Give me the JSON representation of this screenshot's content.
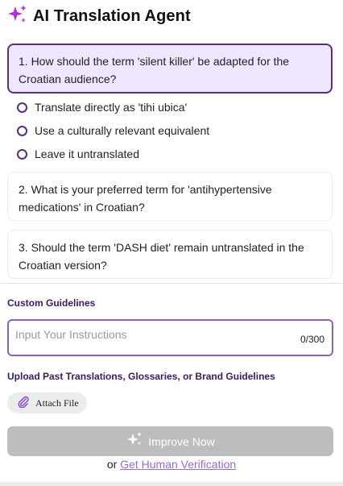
{
  "header": {
    "title": "AI Translation Agent",
    "icon": "sparkle-icon"
  },
  "questions": [
    {
      "text": "1. How should the term 'silent killer' be adapted for the Croatian audience?",
      "options": [
        "Translate directly as 'tihi ubica'",
        "Use a culturally relevant equivalent",
        "Leave it untranslated"
      ]
    },
    {
      "text": "2. What is your preferred term for 'antihypertensive medications' in Croatian?"
    },
    {
      "text": "3. Should the term 'DASH diet' remain untranslated in the Croatian version?"
    }
  ],
  "guidelines": {
    "label": "Custom Guidelines",
    "placeholder": "Input Your Instructions",
    "value": "",
    "counter": "0/300"
  },
  "upload": {
    "label": "Upload Past Translations, Glossaries, or Brand Guidelines",
    "attach_label": "Attach File"
  },
  "actions": {
    "improve_label": "Improve Now",
    "or_text": "or",
    "human_link": "Get Human Verification"
  },
  "colors": {
    "accent": "#5a2d82",
    "active_bg": "#efe6ff",
    "disabled_button": "#bdbdbd",
    "link": "#9a6ad0"
  }
}
